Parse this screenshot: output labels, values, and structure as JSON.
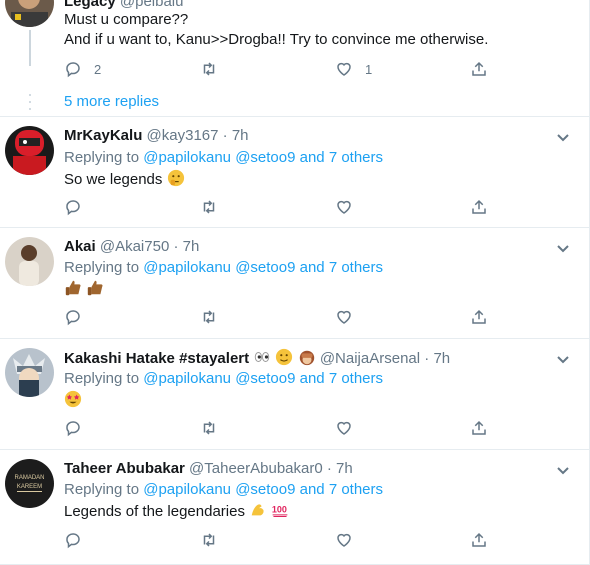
{
  "tweets": [
    {
      "name": "Legacy",
      "handle": "@pelbalu",
      "lines": [
        "Must u compare??",
        "And if u want to, Kanu>>Drogba!! Try to convince me otherwise."
      ],
      "reply_count": "2",
      "like_count": "1",
      "more_replies": "5 more replies"
    },
    {
      "name": "MrKayKalu",
      "handle": "@kay3167",
      "time": "7h",
      "replying_prefix": "Replying to",
      "mention1": "@papilokanu",
      "mention2": "@setoo9",
      "mention_tail": "and 7 others",
      "text": "So we legends"
    },
    {
      "name": "Akai",
      "handle": "@Akai750",
      "time": "7h",
      "replying_prefix": "Replying to",
      "mention1": "@papilokanu",
      "mention2": "@setoo9",
      "mention_tail": "and 7 others",
      "text": ""
    },
    {
      "name": "Kakashi Hatake #stayalert",
      "handle": "@NaijaArsenal",
      "time": "7h",
      "replying_prefix": "Replying to",
      "mention1": "@papilokanu",
      "mention2": "@setoo9",
      "mention_tail": "and 7 others",
      "text": ""
    },
    {
      "name": "Taheer Abubakar",
      "handle": "@TaheerAbubakar0",
      "time": "7h",
      "replying_prefix": "Replying to",
      "mention1": "@papilokanu",
      "mention2": "@setoo9",
      "mention_tail": "and 7 others",
      "text": "Legends of the legendaries",
      "avatar_text1": "RAMADAN",
      "avatar_text2": "KAREEM"
    }
  ],
  "separator": "·",
  "colors": {
    "accent": "#1da1f2",
    "muted": "#657786",
    "border": "#e6ecf0"
  }
}
